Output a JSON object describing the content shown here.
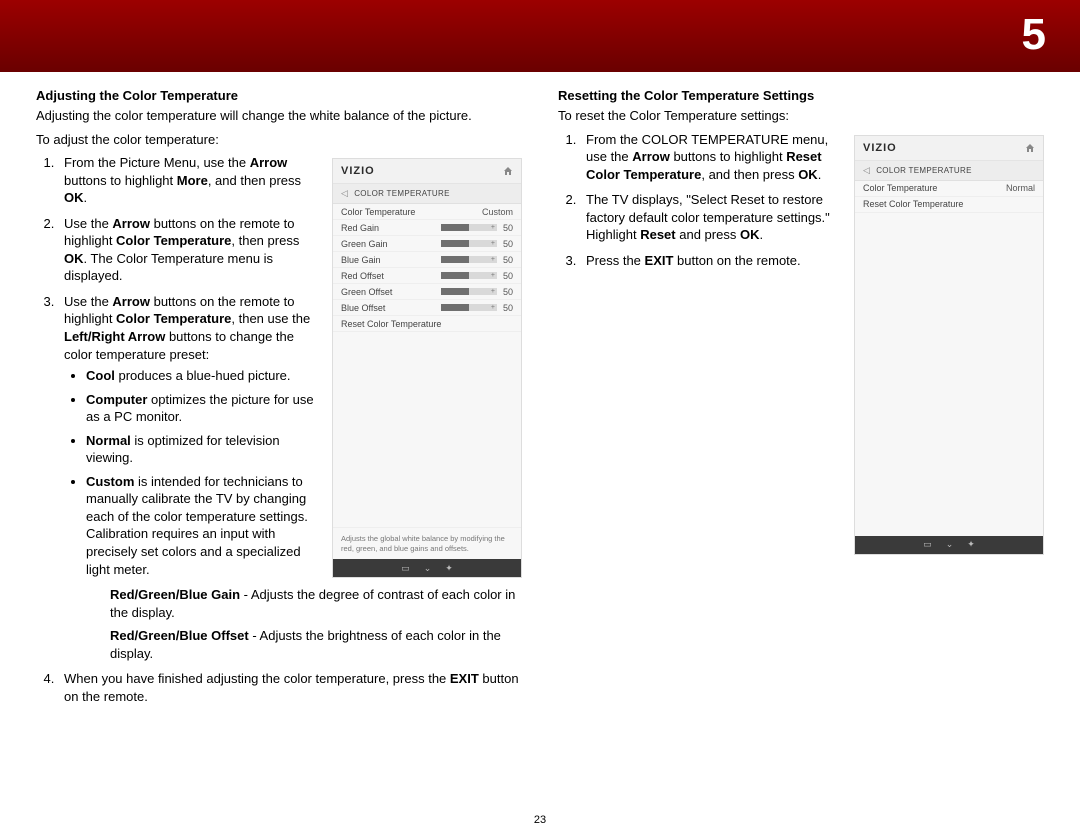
{
  "banner": {
    "page_number": "5"
  },
  "footer_page": "23",
  "left": {
    "heading": "Adjusting the Color Temperature",
    "intro": "Adjusting the color temperature will change the white balance of the picture.",
    "lead": "To adjust the color temperature:",
    "step1_a": "From the Picture Menu, use the ",
    "step1_arrow": "Arrow",
    "step1_b": " buttons to highlight ",
    "step1_more": "More",
    "step1_c": ", and then press ",
    "step1_ok": "OK",
    "step1_d": ".",
    "step2_a": "Use the ",
    "step2_arrow": "Arrow",
    "step2_b": " buttons on the remote to highlight ",
    "step2_ct": "Color Temperature",
    "step2_c": ", then press ",
    "step2_ok": "OK",
    "step2_d": ". The Color Temperature menu is displayed.",
    "step3_a": "Use the ",
    "step3_arrow": "Arrow",
    "step3_b": " buttons on the remote to highlight ",
    "step3_ct": "Color Temperature",
    "step3_c": ", then use the ",
    "step3_lr": "Left/Right Arrow",
    "step3_d": " buttons to change the color temperature preset:",
    "bullet_cool_b": "Cool",
    "bullet_cool": " produces a blue-hued picture.",
    "bullet_comp_b": "Computer",
    "bullet_comp": " optimizes the picture for use as a PC monitor.",
    "bullet_norm_b": "Normal",
    "bullet_norm": " is optimized for television viewing.",
    "bullet_cust_b": "Custom",
    "bullet_cust": " is intended for technicians to manually calibrate the TV by changing each of the color temperature settings. Calibration requires an input with precisely set colors and a specialized light meter.",
    "sub_gain_b": "Red/Green/Blue Gain",
    "sub_gain": " - Adjusts the degree of contrast of each color in the display.",
    "sub_off_b": "Red/Green/Blue Offset",
    "sub_off": " - Adjusts the brightness of each color in the display.",
    "step4_a": "When you have finished adjusting the color temperature, press the ",
    "step4_exit": "EXIT",
    "step4_b": " button on the remote."
  },
  "right": {
    "heading": "Resetting the Color Temperature Settings",
    "lead": "To reset the Color Temperature settings:",
    "step1_a": "From the COLOR TEMPERATURE menu, use the ",
    "step1_arrow": "Arrow",
    "step1_b": " buttons to highlight ",
    "step1_rct": "Reset Color Temperature",
    "step1_c": ", and then press ",
    "step1_ok": "OK",
    "step1_d": ".",
    "step2_a": "The TV displays, \"Select Reset to restore factory default color temperature settings.\" Highlight ",
    "step2_reset": "Reset",
    "step2_b": " and press ",
    "step2_ok": "OK",
    "step2_c": ".",
    "step3_a": "Press the ",
    "step3_exit": "EXIT",
    "step3_b": " button on the remote."
  },
  "osd1": {
    "brand": "VIZIO",
    "crumb": "COLOR TEMPERATURE",
    "ct_label": "Color Temperature",
    "ct_value": "Custom",
    "rows": {
      "red_gain": {
        "label": "Red Gain",
        "value": "50"
      },
      "green_gain": {
        "label": "Green Gain",
        "value": "50"
      },
      "blue_gain": {
        "label": "Blue Gain",
        "value": "50"
      },
      "red_off": {
        "label": "Red Offset",
        "value": "50"
      },
      "green_off": {
        "label": "Green Offset",
        "value": "50"
      },
      "blue_off": {
        "label": "Blue Offset",
        "value": "50"
      }
    },
    "reset": "Reset Color Temperature",
    "help": "Adjusts the global white balance by modifying the red, green, and blue gains and offsets."
  },
  "osd2": {
    "brand": "VIZIO",
    "crumb": "COLOR TEMPERATURE",
    "ct_label": "Color Temperature",
    "ct_value": "Normal",
    "reset": "Reset Color Temperature"
  }
}
